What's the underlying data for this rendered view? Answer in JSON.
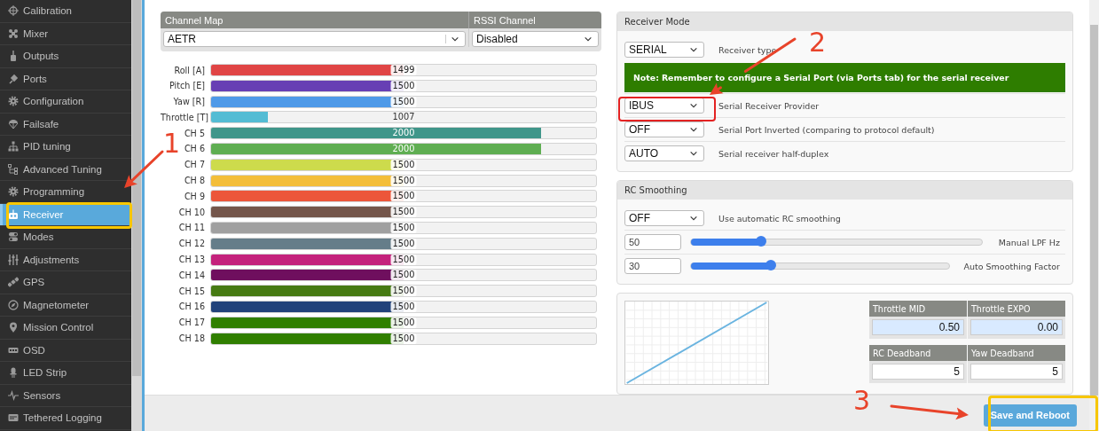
{
  "sidebar": {
    "items": [
      {
        "label": "Calibration",
        "selected": false
      },
      {
        "label": "Mixer",
        "selected": false
      },
      {
        "label": "Outputs",
        "selected": false
      },
      {
        "label": "Ports",
        "selected": false
      },
      {
        "label": "Configuration",
        "selected": false
      },
      {
        "label": "Failsafe",
        "selected": false
      },
      {
        "label": "PID tuning",
        "selected": false
      },
      {
        "label": "Advanced Tuning",
        "selected": false
      },
      {
        "label": "Programming",
        "selected": false
      },
      {
        "label": "Receiver",
        "selected": true
      },
      {
        "label": "Modes",
        "selected": false
      },
      {
        "label": "Adjustments",
        "selected": false
      },
      {
        "label": "GPS",
        "selected": false
      },
      {
        "label": "Magnetometer",
        "selected": false
      },
      {
        "label": "Mission Control",
        "selected": false
      },
      {
        "label": "OSD",
        "selected": false
      },
      {
        "label": "LED Strip",
        "selected": false
      },
      {
        "label": "Sensors",
        "selected": false
      },
      {
        "label": "Tethered Logging",
        "selected": false
      }
    ]
  },
  "channel_map": {
    "header": "Channel Map",
    "value": "AETR"
  },
  "rssi_channel": {
    "header": "RSSI Channel",
    "value": "Disabled"
  },
  "channels": [
    {
      "name": "Roll [A]",
      "value": "1499",
      "level": 0.499,
      "color": "#e04545"
    },
    {
      "name": "Pitch [E]",
      "value": "1500",
      "level": 0.5,
      "color": "#673fb4"
    },
    {
      "name": "Yaw [R]",
      "value": "1500",
      "level": 0.5,
      "color": "#4f9ae8"
    },
    {
      "name": "Throttle [T]",
      "value": "1007",
      "level": 0.148,
      "color": "#54bcd4"
    },
    {
      "name": "CH 5",
      "value": "2000",
      "level": 0.857,
      "color": "#40968a"
    },
    {
      "name": "CH 6",
      "value": "2000",
      "level": 0.857,
      "color": "#5fae52"
    },
    {
      "name": "CH 7",
      "value": "1500",
      "level": 0.5,
      "color": "#cddb4c"
    },
    {
      "name": "CH 8",
      "value": "1500",
      "level": 0.5,
      "color": "#f3be3a"
    },
    {
      "name": "CH 9",
      "value": "1500",
      "level": 0.5,
      "color": "#ec563a"
    },
    {
      "name": "CH 10",
      "value": "1500",
      "level": 0.5,
      "color": "#74564b"
    },
    {
      "name": "CH 11",
      "value": "1500",
      "level": 0.5,
      "color": "#a0a0a0"
    },
    {
      "name": "CH 12",
      "value": "1500",
      "level": 0.5,
      "color": "#657d89"
    },
    {
      "name": "CH 13",
      "value": "1500",
      "level": 0.5,
      "color": "#c4227c"
    },
    {
      "name": "CH 14",
      "value": "1500",
      "level": 0.5,
      "color": "#6f0f5e"
    },
    {
      "name": "CH 15",
      "value": "1500",
      "level": 0.5,
      "color": "#467a13"
    },
    {
      "name": "CH 16",
      "value": "1500",
      "level": 0.5,
      "color": "#22427a"
    },
    {
      "name": "CH 17",
      "value": "1500",
      "level": 0.5,
      "color": "#307f00"
    },
    {
      "name": "CH 18",
      "value": "1500",
      "level": 0.5,
      "color": "#307f00"
    }
  ],
  "receiver_mode": {
    "title": "Receiver Mode",
    "rows": [
      {
        "kind": "select",
        "value": "SERIAL",
        "label": "Receiver type"
      },
      {
        "kind": "note",
        "text": "**Note:** **Remember to configure a Serial Port (via Ports tab) for the serial receiver**"
      },
      {
        "kind": "select",
        "value": "IBUS",
        "label": "Serial Receiver Provider"
      },
      {
        "kind": "select",
        "value": "OFF",
        "label": "Serial Port Inverted (comparing to protocol default)"
      },
      {
        "kind": "select",
        "value": "AUTO",
        "label": "Serial receiver half-duplex"
      }
    ]
  },
  "rc_smoothing": {
    "title": "RC Smoothing",
    "rows": [
      {
        "kind": "select",
        "value": "OFF",
        "label": "Use automatic RC smoothing"
      },
      {
        "kind": "slider",
        "value": "50",
        "level": 0.24,
        "label": "Manual LPF Hz"
      },
      {
        "kind": "slider",
        "value": "30",
        "level": 0.31,
        "label": "Auto Smoothing Factor"
      }
    ]
  },
  "throttle": {
    "fields": [
      {
        "label": "Throttle MID",
        "value": "0.50",
        "highlighted": true
      },
      {
        "label": "Throttle EXPO",
        "value": "0.00",
        "highlighted": true
      },
      {
        "label": "RC Deadband",
        "value": "5",
        "highlighted": false
      },
      {
        "label": "Yaw Deadband",
        "value": "5",
        "highlighted": false
      }
    ]
  },
  "save_button": "Save and Reboot",
  "annotations": [
    {
      "label": "1"
    },
    {
      "label": "2"
    },
    {
      "label": "3"
    }
  ]
}
